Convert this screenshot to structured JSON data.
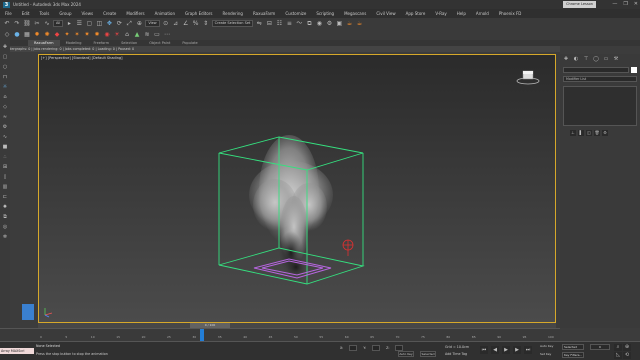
{
  "window": {
    "title": "Untitled - Autodesk 3ds Max 2024",
    "controls": [
      "—",
      "❐",
      "✕"
    ],
    "chroma_button": "Chrome Lesson"
  },
  "menubar": {
    "items": [
      "File",
      "Edit",
      "Tools",
      "Group",
      "Views",
      "Create",
      "Modifiers",
      "Animation",
      "Graph Editors",
      "Rendering",
      "RaxuaFarm",
      "Customize",
      "Scripting",
      "Megascans",
      "Civil View",
      "App Store",
      "V-Ray",
      "Help",
      "Arnold",
      "Phoenix FD"
    ],
    "sign_in": "Sign In",
    "workspace_label": "Workspaces:",
    "workspace_value": "Default",
    "project_path": "C:\\Users\\...\\3ds Max 2024"
  },
  "toolbar": {
    "selection_filter": "All",
    "selection_set": "Create Selection Set",
    "view_dropdown": "View"
  },
  "ribbon": {
    "tabs": [
      "RaxuaFarm",
      "Modeling",
      "Freeform",
      "Selection",
      "Object Paint",
      "Populate"
    ],
    "active_tab": "RaxuaFarm"
  },
  "breadcrumb": "Rendergraphs: 0 | Jobs rendering: 0 | Jobs completed: 0 | Loading: 0 | Paused: 0",
  "viewport": {
    "label": "[+] [Perspective] [Standard] [Default Shading]",
    "border_color": "#d6a82a",
    "container_color": "#35e07f",
    "emitter_color": "#b766e0",
    "helper_color": "#e03030"
  },
  "command_panel": {
    "field2_text": "Modifier List"
  },
  "timeline": {
    "slider_label": "0 / 100",
    "ticks": [
      "0",
      "5",
      "10",
      "15",
      "20",
      "25",
      "30",
      "35",
      "40",
      "45",
      "50",
      "55",
      "60",
      "65",
      "70",
      "75",
      "80",
      "85",
      "90",
      "95",
      "100"
    ]
  },
  "status": {
    "maxscript_label": "Array MAXScri",
    "selection_status": "None Selected",
    "prompt": "Press the stop button to stop the animation",
    "x_label": "X:",
    "y_label": "Y:",
    "z_label": "Z:",
    "grid": "Grid = 10.0cm",
    "add_time_tag": "Add Time Tag",
    "autokey_label": "Auto Key",
    "selected_label": "Selected",
    "setkey_label": "Set Key",
    "selected_btn": "Selected",
    "key_filters": "Key Filters...",
    "frame_value": "0"
  }
}
